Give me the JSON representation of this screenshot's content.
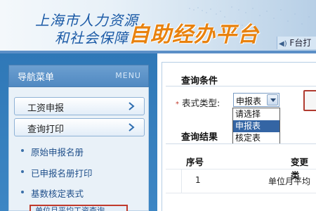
{
  "header": {
    "title_line1": "上海市人力资源",
    "title_line2": "和社会保障",
    "brand": "自助经办平台",
    "sound_label": "F台打"
  },
  "sidebar": {
    "nav_title": "导航菜单",
    "nav_menu": "MENU",
    "buttons": [
      {
        "label": "工资申报"
      },
      {
        "label": "查询打印"
      }
    ],
    "sub_items": [
      {
        "label": "原始申报名册"
      },
      {
        "label": "已申报名册打印"
      },
      {
        "label": "基数核定表式"
      },
      {
        "label": "单位月平均工资查询"
      }
    ]
  },
  "main": {
    "query_section": "查询条件",
    "result_section": "查询结果",
    "form": {
      "required_mark": "*",
      "type_label": "表式类型:",
      "selected_value": "申报表",
      "options": [
        "请选择",
        "申报表",
        "核定表"
      ],
      "highlighted_option": "申报表"
    },
    "table": {
      "headers": [
        "序号",
        "变更类"
      ],
      "rows": [
        {
          "index": "1",
          "type": "单位月平均"
        }
      ]
    }
  },
  "colors": {
    "brand_orange": "#e8820f",
    "title_blue": "#1b5aa6",
    "sidebar_blue": "#2f78b7",
    "highlight_red": "#c0392b",
    "selection_blue": "#3465a4"
  }
}
